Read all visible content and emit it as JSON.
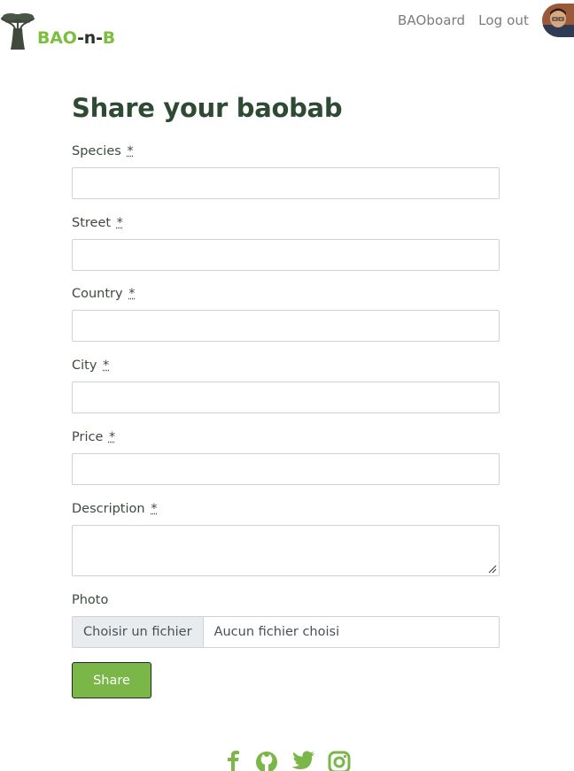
{
  "brand": {
    "logo_text_bao": "BAO",
    "logo_text_dash1": "-n-",
    "logo_text_b": "B"
  },
  "nav": {
    "links": [
      "BAOboard",
      "Log out"
    ]
  },
  "page": {
    "title": "Share your baobab"
  },
  "form": {
    "required_marker": "*",
    "fields": [
      {
        "label": "Species",
        "value": "",
        "required": true
      },
      {
        "label": "Street",
        "value": "",
        "required": true
      },
      {
        "label": "Country",
        "value": "",
        "required": true
      },
      {
        "label": "City",
        "value": "",
        "required": true
      },
      {
        "label": "Price",
        "value": "",
        "required": true
      },
      {
        "label": "Description",
        "value": "",
        "required": true
      }
    ],
    "photo": {
      "label": "Photo",
      "button_label": "Choisir un fichier",
      "file_status": "Aucun fichier choisi"
    },
    "submit_label": "Share"
  },
  "footer": {
    "icons": [
      "facebook-icon",
      "github-icon",
      "twitter-icon",
      "instagram-icon"
    ]
  },
  "colors": {
    "accent": "#7ab648",
    "heading": "#2f4a34",
    "logo_green": "#7bbf3f"
  }
}
